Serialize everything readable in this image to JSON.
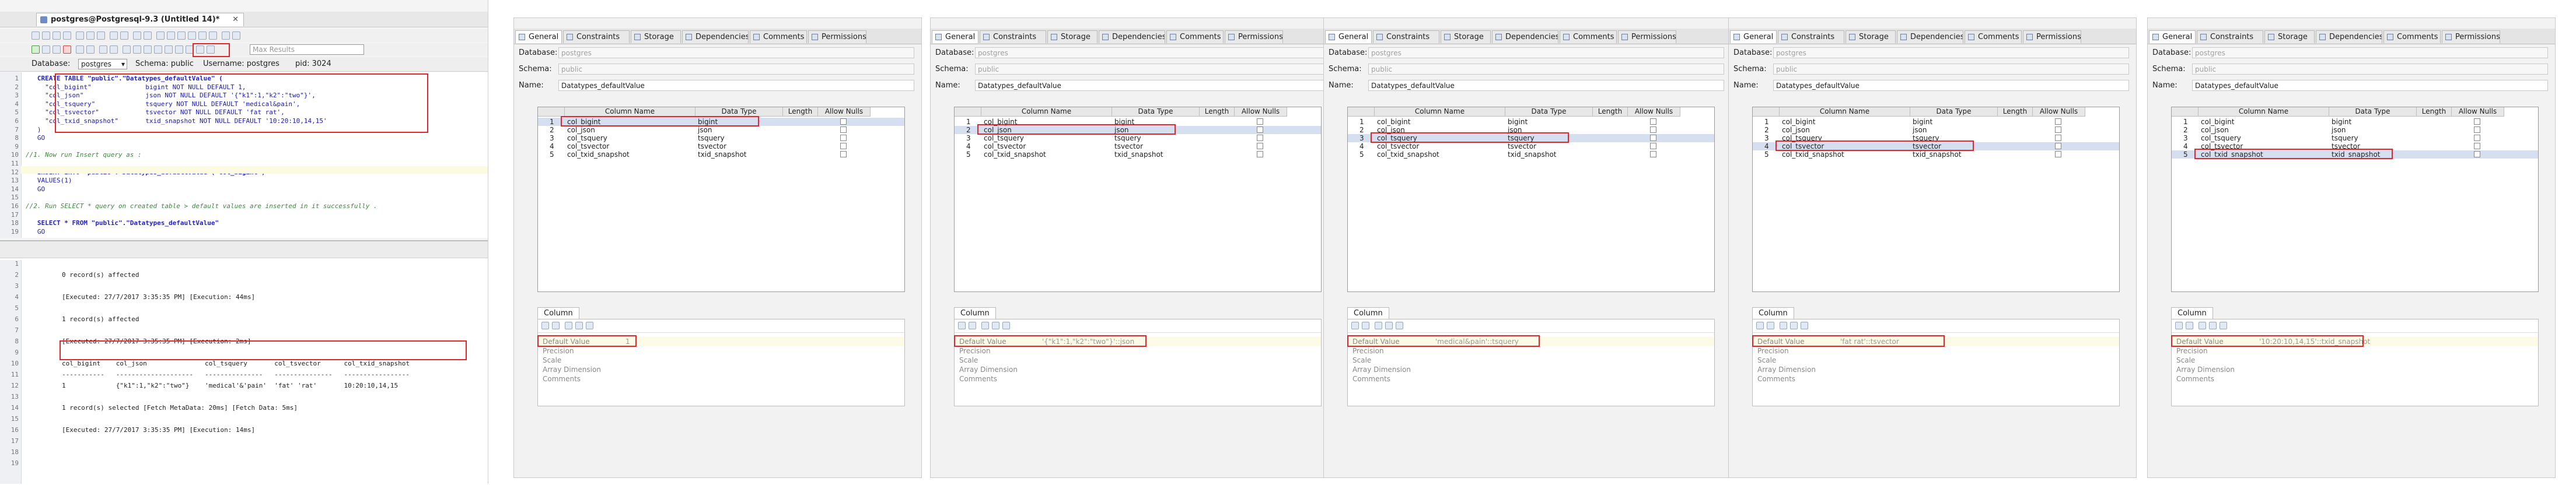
{
  "editor": {
    "tab_title": "postgres@Postgresql-9.3 (Untitled 14)*",
    "database_label": "Database:",
    "database_value": "postgres",
    "schema_text": "Schema: public",
    "username_text": "Username: postgres",
    "pid_text": "pid: 3024",
    "max_results_placeholder": "Max Results",
    "code_lines": [
      {
        "n": "1",
        "t": "   CREATE TABLE \"public\".\"Datatypes_defaultValue\" (",
        "c": "kw"
      },
      {
        "n": "2",
        "t": "     \"col_bigint\"              bigint NOT NULL DEFAULT 1,",
        "c": ""
      },
      {
        "n": "3",
        "t": "     \"col_json\"                json NOT NULL DEFAULT '{\"k1\":1,\"k2\":\"two\"}',",
        "c": ""
      },
      {
        "n": "4",
        "t": "     \"col_tsquery\"             tsquery NOT NULL DEFAULT 'medical&pain',",
        "c": ""
      },
      {
        "n": "5",
        "t": "     \"col_tsvector\"            tsvector NOT NULL DEFAULT 'fat rat',",
        "c": ""
      },
      {
        "n": "6",
        "t": "     \"col_txid_snapshot\"       txid_snapshot NOT NULL DEFAULT '10:20:10,14,15'",
        "c": ""
      },
      {
        "n": "7",
        "t": "   )",
        "c": ""
      },
      {
        "n": "8",
        "t": "   GO",
        "c": ""
      },
      {
        "n": "9",
        "t": "",
        "c": ""
      },
      {
        "n": "10",
        "t": "//1. Now run Insert query as :",
        "c": "cmt"
      },
      {
        "n": "11",
        "t": "",
        "c": ""
      },
      {
        "n": "12",
        "t": "   INSERT INTO \"public\".\"Datatypes_defaultValue\"(\"col_bigint\")",
        "c": "kw"
      },
      {
        "n": "13",
        "t": "   VALUES(1)",
        "c": ""
      },
      {
        "n": "14",
        "t": "   GO",
        "c": ""
      },
      {
        "n": "15",
        "t": "",
        "c": ""
      },
      {
        "n": "16",
        "t": "//2. Run SELECT * query on created table > default values are inserted in it successfully .",
        "c": "cmt"
      },
      {
        "n": "17",
        "t": "",
        "c": ""
      },
      {
        "n": "18",
        "t": "   SELECT * FROM \"public\".\"Datatypes_defaultValue\"",
        "c": "kw"
      },
      {
        "n": "19",
        "t": "   GO",
        "c": ""
      }
    ],
    "output_lines": [
      {
        "n": "1",
        "t": ""
      },
      {
        "n": "2",
        "t": "0 record(s) affected"
      },
      {
        "n": "3",
        "t": ""
      },
      {
        "n": "4",
        "t": "[Executed: 27/7/2017 3:35:35 PM] [Execution: 44ms]"
      },
      {
        "n": "5",
        "t": ""
      },
      {
        "n": "6",
        "t": "1 record(s) affected"
      },
      {
        "n": "7",
        "t": ""
      },
      {
        "n": "8",
        "t": "[Executed: 27/7/2017 3:35:35 PM] [Execution: 2ms]"
      },
      {
        "n": "9",
        "t": ""
      },
      {
        "n": "10",
        "t": "col_bigint    col_json               col_tsquery       col_tsvector      col_txid_snapshot"
      },
      {
        "n": "11",
        "t": "-----------   --------------------   ---------------   ---------------   -----------------"
      },
      {
        "n": "12",
        "t": "1             {\"k1\":1,\"k2\":\"two\"}    'medical'&'pain'  'fat' 'rat'       10:20:10,14,15"
      },
      {
        "n": "13",
        "t": ""
      },
      {
        "n": "14",
        "t": "1 record(s) selected [Fetch MetaData: 20ms] [Fetch Data: 5ms]"
      },
      {
        "n": "15",
        "t": ""
      },
      {
        "n": "16",
        "t": "[Executed: 27/7/2017 3:35:35 PM] [Execution: 14ms]"
      },
      {
        "n": "17",
        "t": ""
      },
      {
        "n": "18",
        "t": ""
      },
      {
        "n": "19",
        "t": ""
      }
    ]
  },
  "props": {
    "tabs": [
      "General",
      "Constraints",
      "Storage",
      "Dependencies",
      "Comments",
      "Permissions"
    ],
    "database_label": "Database:",
    "database_value": "postgres",
    "schema_label": "Schema:",
    "schema_value": "public",
    "name_label": "Name:",
    "name_value": "Datatypes_defaultValue",
    "headers": [
      "Column Name",
      "Data Type",
      "Length",
      "Allow Nulls"
    ],
    "rows": [
      {
        "n": "1",
        "name": "col_bigint",
        "type": "bigint"
      },
      {
        "n": "2",
        "name": "col_json",
        "type": "json"
      },
      {
        "n": "3",
        "name": "col_tsquery",
        "type": "tsquery"
      },
      {
        "n": "4",
        "name": "col_tsvector",
        "type": "tsvector"
      },
      {
        "n": "5",
        "name": "col_txid_snapshot",
        "type": "txid_snapshot"
      }
    ],
    "column_tab": "Column",
    "prop_keys": [
      "Default Value",
      "Precision",
      "Scale",
      "Array Dimension",
      "Comments"
    ],
    "defaults": [
      "1",
      "'{\"k1\":1,\"k2\":\"two\"}'::json",
      "'medical&pain'::tsquery",
      "'fat rat'::tsvector",
      "'10:20:10,14,15'::txid_snapshot"
    ]
  }
}
